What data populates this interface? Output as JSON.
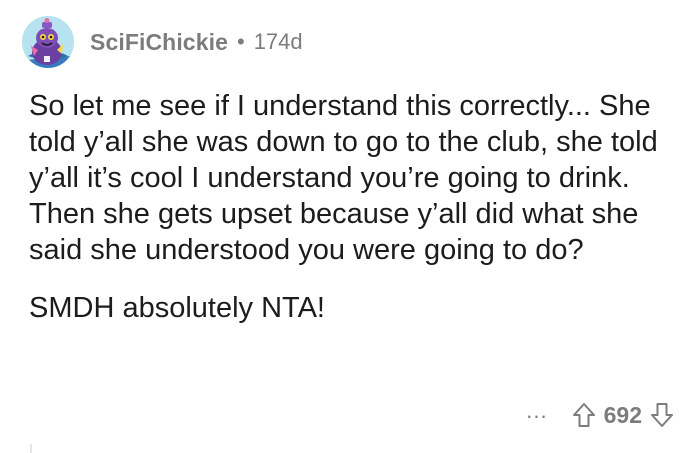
{
  "comment": {
    "author": "SciFiChickie",
    "separator": "•",
    "age": "174d",
    "paragraphs": [
      "So let me see if I understand this correctly... She told y’all she was down to go to the club, she told y’all it’s cool I understand you’re going to drink. Then she gets upset because y’all did what she said she understood you were going to do?",
      "SMDH absolutely NTA!"
    ],
    "more_label": "...",
    "score": "692"
  },
  "icons": {
    "avatar": "snoo-avatar-icon",
    "upvote": "upvote-arrow-icon",
    "downvote": "downvote-arrow-icon"
  },
  "colors": {
    "text": "#1c1c1c",
    "meta": "#7c7c7c",
    "avatar_bg": "#b7e3f0",
    "avatar_accent": "#6b3fa0"
  }
}
